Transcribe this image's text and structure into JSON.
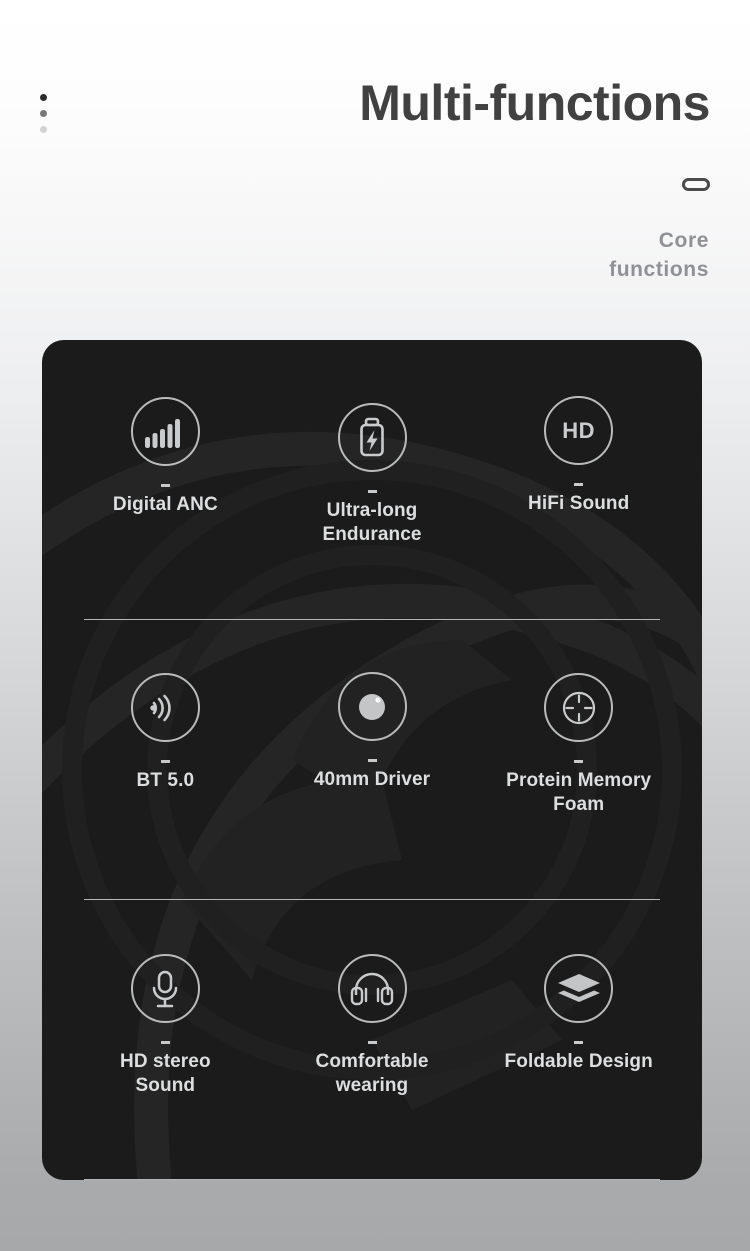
{
  "header": {
    "title": "Multi-functions",
    "subtitle_line1": "Core",
    "subtitle_line2": "functions",
    "dots": [
      "dot-active",
      "dot-medium",
      "dot-faded"
    ],
    "pill_icon": "pill-capsule-icon"
  },
  "colors": {
    "card_background": "#1b1b1b",
    "page_background_top": "#ffffff",
    "page_background_bottom": "#a6a8aa",
    "icon_stroke": "#b9bbbd",
    "label_text": "#dcdedf",
    "title_text": "#414141",
    "subtitle_text": "#8f9194",
    "divider": "#b5b7b9"
  },
  "features": {
    "rows": [
      {
        "items": [
          {
            "label": "Digital ANC",
            "icon": "signal-bars-icon"
          },
          {
            "label": "Ultra-long\nEndurance",
            "label_line1": "Ultra-long",
            "label_line2": "Endurance",
            "icon": "battery-bolt-icon"
          },
          {
            "label": "HiFi Sound",
            "icon": "hd-badge-icon",
            "icon_text": "HD"
          }
        ]
      },
      {
        "items": [
          {
            "label": "BT 5.0",
            "icon": "bluetooth-waves-icon"
          },
          {
            "label": "40mm Driver",
            "icon": "speaker-driver-icon"
          },
          {
            "label": "Protein Memory\nFoam",
            "label_line1": "Protein Memory",
            "label_line2": "Foam",
            "icon": "crosshair-target-icon"
          }
        ]
      },
      {
        "items": [
          {
            "label": "HD stereo\nSound",
            "label_line1": "HD stereo",
            "label_line2": "Sound",
            "icon": "microphone-icon"
          },
          {
            "label": "Comfortable\nwearing",
            "label_line1": "Comfortable",
            "label_line2": "wearing",
            "icon": "headphones-icon"
          },
          {
            "label": "Foldable Design",
            "icon": "stacked-layers-icon"
          }
        ]
      }
    ]
  }
}
